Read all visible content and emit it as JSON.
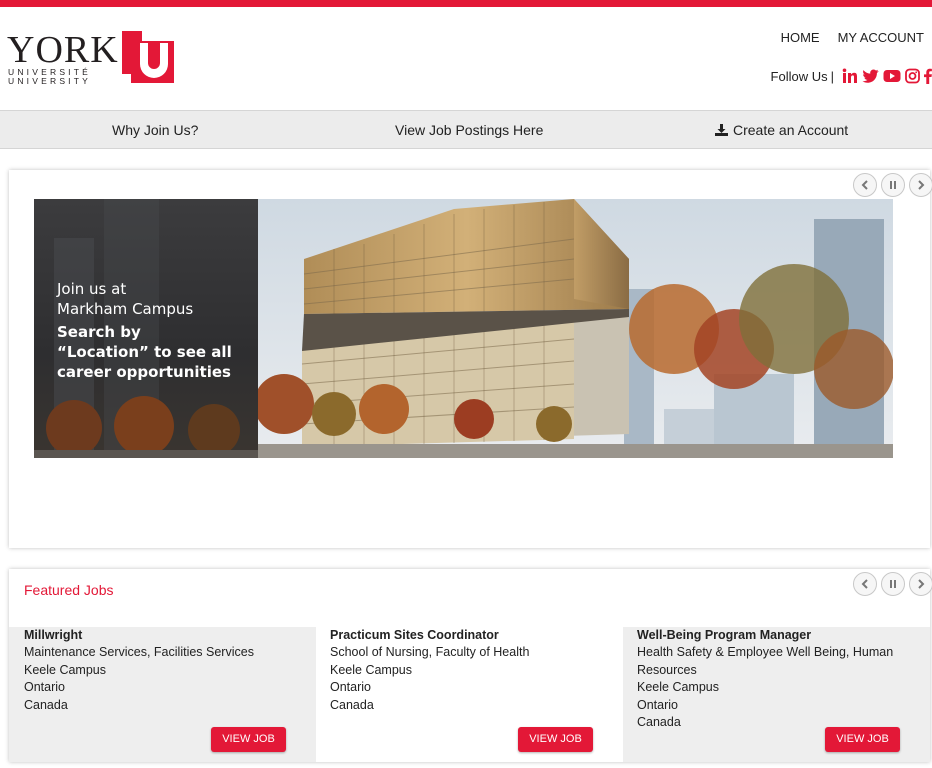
{
  "brand": {
    "name": "YORK",
    "line_fr": "UNIVERSITÉ",
    "line_en": "UNIVERSITY",
    "logo_letter": "U",
    "color": "#e31837"
  },
  "top_nav": {
    "home": "HOME",
    "account": "MY ACCOUNT"
  },
  "follow": {
    "label": "Follow Us",
    "separator": "|",
    "icons": [
      "linkedin-icon",
      "twitter-icon",
      "youtube-icon",
      "instagram-icon",
      "facebook-icon"
    ]
  },
  "menu": {
    "why": "Why Join Us?",
    "postings": "View Job Postings Here",
    "create": "Create an Account"
  },
  "banner": {
    "line1": "Join us at",
    "line2": "Markham Campus",
    "line3": "Search by",
    "line4": "“Location” to see all",
    "line5": "career opportunities"
  },
  "featured": {
    "title": "Featured Jobs",
    "jobs": [
      {
        "title": "Millwright",
        "dept": "Maintenance Services, Facilities Services",
        "campus": "Keele Campus",
        "province": "Ontario",
        "country": "Canada",
        "button": "VIEW JOB"
      },
      {
        "title": "Practicum Sites Coordinator",
        "dept": "School of Nursing, Faculty of Health",
        "campus": "Keele Campus",
        "province": "Ontario",
        "country": "Canada",
        "button": "VIEW JOB"
      },
      {
        "title": "Well-Being Program Manager",
        "dept": "Health Safety & Employee Well Being, Human Resources",
        "campus": "Keele Campus",
        "province": "Ontario",
        "country": "Canada",
        "button": "VIEW JOB"
      }
    ]
  }
}
